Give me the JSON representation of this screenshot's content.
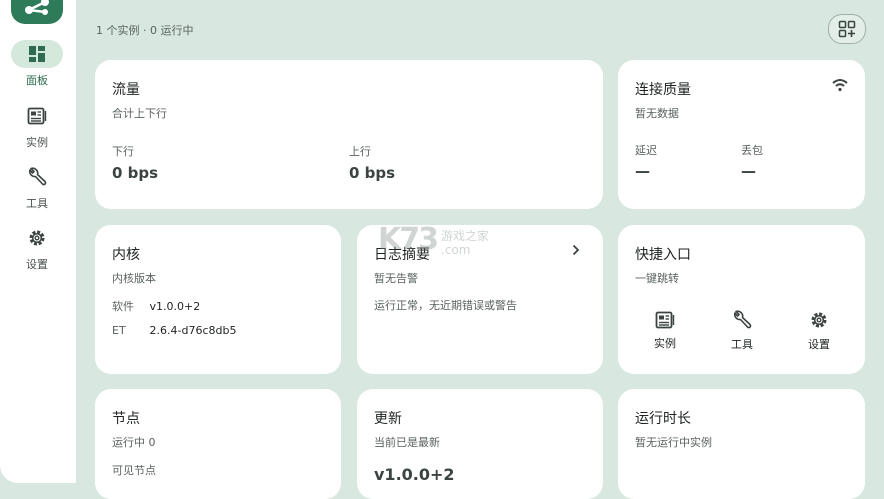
{
  "sidebar": {
    "items": [
      {
        "label": "面板",
        "icon": "dashboard-icon"
      },
      {
        "label": "实例",
        "icon": "instances-icon"
      },
      {
        "label": "工具",
        "icon": "wrench-icon"
      },
      {
        "label": "设置",
        "icon": "gear-icon"
      }
    ]
  },
  "header": {
    "summary": "1 个实例 · 0 运行中"
  },
  "traffic": {
    "title": "流量",
    "subtitle": "合计上下行",
    "down_label": "下行",
    "down_value": "0 bps",
    "up_label": "上行",
    "up_value": "0 bps"
  },
  "connection": {
    "title": "连接质量",
    "subtitle": "暂无数据",
    "latency_label": "延迟",
    "latency_value": "—",
    "loss_label": "丢包",
    "loss_value": "—"
  },
  "kernel": {
    "title": "内核",
    "subtitle": "内核版本",
    "software_label": "软件",
    "software_value": "v1.0.0+2",
    "et_label": "ET",
    "et_value": "2.6.4-d76c8db5"
  },
  "logs": {
    "title": "日志摘要",
    "subtitle": "暂无告警",
    "message": "运行正常，无近期错误或警告"
  },
  "quick": {
    "title": "快捷入口",
    "subtitle": "一键跳转",
    "items": [
      {
        "label": "实例",
        "icon": "instances-icon"
      },
      {
        "label": "工具",
        "icon": "wrench-icon"
      },
      {
        "label": "设置",
        "icon": "gear-icon"
      }
    ]
  },
  "nodes": {
    "title": "节点",
    "subtitle": "运行中 0",
    "visible_label": "可见节点"
  },
  "update": {
    "title": "更新",
    "subtitle": "当前已是最新",
    "version": "v1.0.0+2"
  },
  "uptime": {
    "title": "运行时长",
    "subtitle": "暂无运行中实例"
  },
  "watermark": {
    "text": "游戏之家",
    "sub": ".com"
  },
  "colors": {
    "accent": "#2e7b5a",
    "background": "#d8e7df",
    "card": "#ffffff"
  }
}
